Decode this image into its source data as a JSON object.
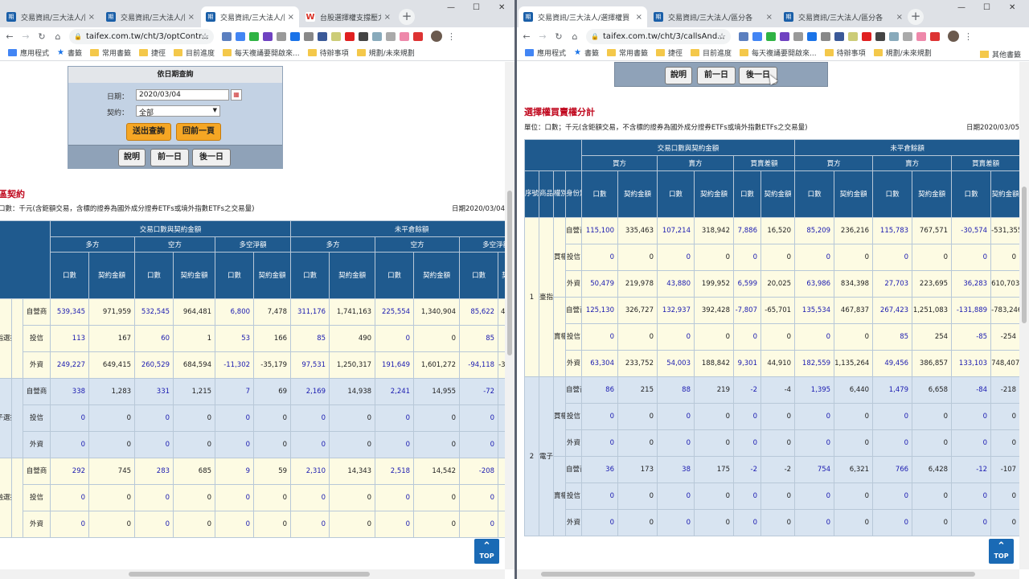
{
  "left": {
    "tabs": [
      {
        "title": "交易資訊/三大法人/區",
        "close": "×"
      },
      {
        "title": "交易資訊/三大法人/區",
        "close": "×"
      },
      {
        "title": "交易資訊/三大法人/區",
        "close": "×"
      },
      {
        "title": "台股選擇權支撐壓力",
        "close": "×"
      }
    ],
    "url": "taifex.com.tw/cht/3/optContr...",
    "window_controls": {
      "min": "—",
      "max": "☐",
      "close": "✕"
    },
    "bookmarks": [
      {
        "label": "應用程式",
        "icon": "apps"
      },
      {
        "label": "書籤",
        "icon": "star"
      },
      {
        "label": "常用書籤",
        "icon": "folder"
      },
      {
        "label": "捷徑",
        "icon": "folder"
      },
      {
        "label": "目前進度",
        "icon": "folder"
      },
      {
        "label": "每天複誦要開啟來...",
        "icon": "folder"
      },
      {
        "label": "待辦事項",
        "icon": "folder"
      },
      {
        "label": "規劃/未來規劃",
        "icon": "folder"
      }
    ],
    "query": {
      "title": "依日期查詢",
      "date_label": "日期：",
      "date_value": "2020/03/04",
      "contract_label": "契約：",
      "contract_value": "全部",
      "submit": "送出查詢",
      "back": "回前一頁",
      "help": "說明",
      "prev": "前一日",
      "next": "後一日"
    },
    "section_title": "區契約",
    "unit": "口數：千元(含鉅額交易，含標的證券為國外成分證券ETFs或境外指數ETFs之交易量)",
    "date": "日期2020/03/04",
    "headers": {
      "trade": "交易口數與契約金額",
      "oi": "未平倉餘額",
      "long": "多方",
      "short": "空方",
      "net": "多空淨額",
      "vol": "口數",
      "amt": "契約金額",
      "product": "商品名稱",
      "identity": "身份別"
    },
    "groups": [
      {
        "name": "臺指選擇權",
        "rows": [
          {
            "id": "自營商",
            "v": [
              "539,345",
              "971,959",
              "532,545",
              "964,481",
              "6,800",
              "7,478",
              "311,176",
              "1,741,163",
              "225,554",
              "1,340,904",
              "85,622",
              "400,259"
            ]
          },
          {
            "id": "投信",
            "v": [
              "113",
              "167",
              "60",
              "1",
              "53",
              "166",
              "85",
              "490",
              "0",
              "0",
              "85",
              "490"
            ]
          },
          {
            "id": "外資",
            "v": [
              "249,227",
              "649,415",
              "260,529",
              "684,594",
              "-11,302",
              "-35,179",
              "97,531",
              "1,250,317",
              "191,649",
              "1,601,272",
              "-94,118",
              "-350,955"
            ]
          }
        ]
      },
      {
        "name": "電子選擇權",
        "rows": [
          {
            "id": "自營商",
            "v": [
              "338",
              "1,283",
              "331",
              "1,215",
              "7",
              "69",
              "2,169",
              "14,938",
              "2,241",
              "14,955",
              "-72",
              "-17"
            ]
          },
          {
            "id": "投信",
            "v": [
              "0",
              "0",
              "0",
              "0",
              "0",
              "0",
              "0",
              "0",
              "0",
              "0",
              "0",
              "0"
            ]
          },
          {
            "id": "外資",
            "v": [
              "0",
              "0",
              "0",
              "0",
              "0",
              "0",
              "0",
              "0",
              "0",
              "0",
              "0",
              "0"
            ]
          }
        ]
      },
      {
        "name": "金融選擇權",
        "rows": [
          {
            "id": "自營商",
            "v": [
              "292",
              "745",
              "283",
              "685",
              "9",
              "59",
              "2,310",
              "14,343",
              "2,518",
              "14,542",
              "-208",
              "-199"
            ]
          },
          {
            "id": "投信",
            "v": [
              "0",
              "0",
              "0",
              "0",
              "0",
              "0",
              "0",
              "0",
              "0",
              "0",
              "0",
              "0"
            ]
          },
          {
            "id": "外資",
            "v": [
              "0",
              "0",
              "0",
              "0",
              "0",
              "0",
              "0",
              "0",
              "0",
              "0",
              "0",
              "0"
            ]
          }
        ]
      }
    ],
    "top": "TOP"
  },
  "right": {
    "tabs": [
      {
        "title": "交易資訊/三大法人/選擇權買",
        "close": "×"
      },
      {
        "title": "交易資訊/三大法人/區分各",
        "close": "×"
      },
      {
        "title": "交易資訊/三大法人/區分各",
        "close": "×"
      }
    ],
    "url": "taifex.com.tw/cht/3/callsAnd...",
    "window_controls": {
      "min": "—",
      "max": "☐",
      "close": "✕"
    },
    "bookmarks": [
      {
        "label": "應用程式",
        "icon": "apps"
      },
      {
        "label": "書籤",
        "icon": "star"
      },
      {
        "label": "常用書籤",
        "icon": "folder"
      },
      {
        "label": "捷徑",
        "icon": "folder"
      },
      {
        "label": "目前進度",
        "icon": "folder"
      },
      {
        "label": "每天複誦要開啟來...",
        "icon": "folder"
      },
      {
        "label": "待辦事項",
        "icon": "folder"
      },
      {
        "label": "規劃/未來規劃",
        "icon": "folder"
      }
    ],
    "other_bookmarks": "其他書籤",
    "query": {
      "help": "說明",
      "prev": "前一日",
      "next": "後一日"
    },
    "section_title": "選擇權買賣權分計",
    "unit": "單位：口數；千元(含鉅額交易，不含標的證券為國外成分證券ETFs或境外指數ETFs之交易量)",
    "date": "日期2020/03/05",
    "headers": {
      "trade": "交易口數與契約金額",
      "oi": "未平倉餘額",
      "buy": "買方",
      "sell": "賣方",
      "diff": "買賣差額",
      "vol": "口數",
      "amt": "契約金額",
      "seq": "序號",
      "product": "商品名稱",
      "right": "權別",
      "identity": "身份別"
    },
    "groups": [
      {
        "seq": "1",
        "name": "臺指選擇權",
        "rights": [
          {
            "name": "買權",
            "rows": [
              {
                "id": "自營商",
                "v": [
                  "115,100",
                  "335,463",
                  "107,214",
                  "318,942",
                  "7,886",
                  "16,520",
                  "85,209",
                  "236,216",
                  "115,783",
                  "767,571",
                  "-30,574",
                  "-531,355"
                ]
              },
              {
                "id": "投信",
                "v": [
                  "0",
                  "0",
                  "0",
                  "0",
                  "0",
                  "0",
                  "0",
                  "0",
                  "0",
                  "0",
                  "0",
                  "0"
                ]
              },
              {
                "id": "外資",
                "v": [
                  "50,479",
                  "219,978",
                  "43,880",
                  "199,952",
                  "6,599",
                  "20,025",
                  "63,986",
                  "834,398",
                  "27,703",
                  "223,695",
                  "36,283",
                  "610,703"
                ]
              }
            ]
          },
          {
            "name": "賣權",
            "rows": [
              {
                "id": "自營商",
                "v": [
                  "125,130",
                  "326,727",
                  "132,937",
                  "392,428",
                  "-7,807",
                  "-65,701",
                  "135,534",
                  "467,837",
                  "267,423",
                  "1,251,083",
                  "-131,889",
                  "-783,246"
                ]
              },
              {
                "id": "投信",
                "v": [
                  "0",
                  "0",
                  "0",
                  "0",
                  "0",
                  "0",
                  "0",
                  "0",
                  "85",
                  "254",
                  "-85",
                  "-254"
                ]
              },
              {
                "id": "外資",
                "v": [
                  "63,304",
                  "233,752",
                  "54,003",
                  "188,842",
                  "9,301",
                  "44,910",
                  "182,559",
                  "1,135,264",
                  "49,456",
                  "386,857",
                  "133,103",
                  "748,407"
                ]
              }
            ]
          }
        ]
      },
      {
        "seq": "2",
        "name": "電子選擇權",
        "rights": [
          {
            "name": "買權",
            "rows": [
              {
                "id": "自營商",
                "v": [
                  "86",
                  "215",
                  "88",
                  "219",
                  "-2",
                  "-4",
                  "1,395",
                  "6,440",
                  "1,479",
                  "6,658",
                  "-84",
                  "-218"
                ]
              },
              {
                "id": "投信",
                "v": [
                  "0",
                  "0",
                  "0",
                  "0",
                  "0",
                  "0",
                  "0",
                  "0",
                  "0",
                  "0",
                  "0",
                  "0"
                ]
              },
              {
                "id": "外資",
                "v": [
                  "0",
                  "0",
                  "0",
                  "0",
                  "0",
                  "0",
                  "0",
                  "0",
                  "0",
                  "0",
                  "0",
                  "0"
                ]
              }
            ]
          },
          {
            "name": "賣權",
            "rows": [
              {
                "id": "自營商",
                "v": [
                  "36",
                  "173",
                  "38",
                  "175",
                  "-2",
                  "-2",
                  "754",
                  "6,321",
                  "766",
                  "6,428",
                  "-12",
                  "-107"
                ]
              },
              {
                "id": "投信",
                "v": [
                  "0",
                  "0",
                  "0",
                  "0",
                  "0",
                  "0",
                  "0",
                  "0",
                  "0",
                  "0",
                  "0",
                  "0"
                ]
              },
              {
                "id": "外資",
                "v": [
                  "0",
                  "0",
                  "0",
                  "0",
                  "0",
                  "0",
                  "0",
                  "0",
                  "0",
                  "0",
                  "0",
                  "0"
                ]
              }
            ]
          }
        ]
      }
    ],
    "top": "TOP"
  }
}
